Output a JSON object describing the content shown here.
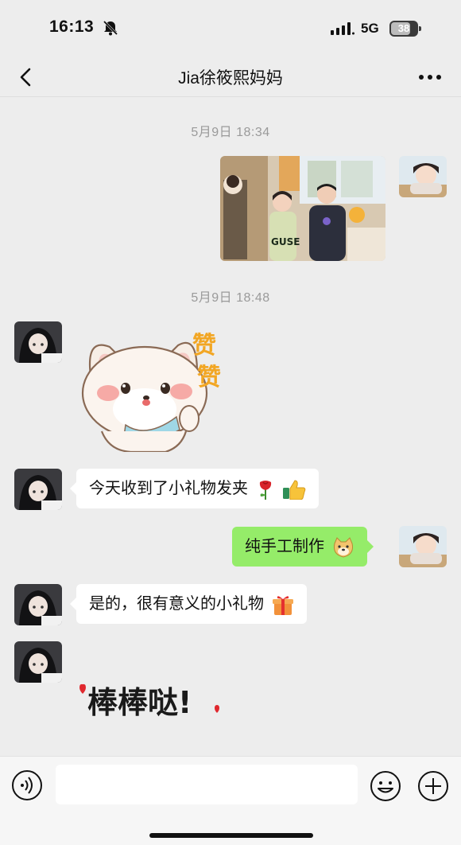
{
  "status_bar": {
    "time": "16:13",
    "network": "5G",
    "battery": "38"
  },
  "header": {
    "title": "Jia徐筱熙妈妈"
  },
  "messages": {
    "timestamp_1": "5月9日 18:34",
    "timestamp_2": "5月9日 18:48",
    "sticker_zan": "赞",
    "msg_gift_received": "今天收到了小礼物发夹",
    "msg_handmade": "纯手工制作",
    "msg_meaningful": "是的，很有意义的小礼物",
    "sticker_bangbang": "棒棒哒!",
    "photo_shirt_text": "GUSE"
  },
  "icons": {
    "back": "chevron-left-icon",
    "more": "ellipsis-icon",
    "voice": "voice-icon",
    "emoji": "smile-icon",
    "plus": "plus-icon"
  },
  "colors": {
    "background": "#ededed",
    "bubble_self": "#95ec69",
    "bubble_other": "#ffffff",
    "timestamp": "#9a9a9a"
  }
}
